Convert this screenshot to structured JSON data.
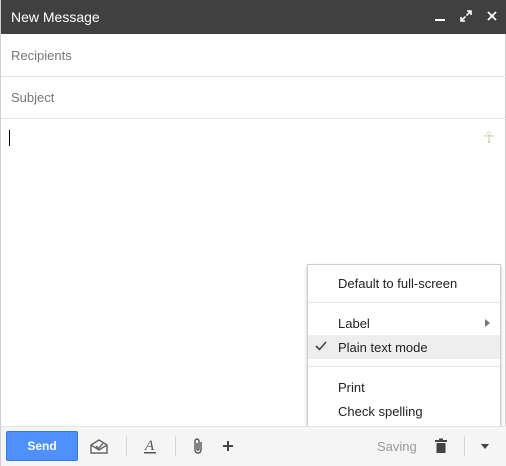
{
  "window": {
    "title": "New Message"
  },
  "fields": {
    "recipients_placeholder": "Recipients",
    "subject_placeholder": "Subject"
  },
  "body": {
    "text": "",
    "signature_icon": "ankh-icon"
  },
  "menu": {
    "items": [
      {
        "label": "Default to full-screen",
        "checked": false,
        "submenu": false
      },
      {
        "label": "Label",
        "checked": false,
        "submenu": true
      },
      {
        "label": "Plain text mode",
        "checked": true,
        "submenu": false,
        "highlighted": true
      },
      {
        "label": "Print",
        "checked": false,
        "submenu": false
      },
      {
        "label": "Check spelling",
        "checked": false,
        "submenu": false
      }
    ]
  },
  "toolbar": {
    "send_label": "Send",
    "status_text": "Saving",
    "icons": [
      "confidential-mode-icon",
      "formatting-icon",
      "attach-icon",
      "plus-icon",
      "trash-icon",
      "more-options-icon"
    ]
  },
  "colors": {
    "titlebar": "#404040",
    "send": "#4d90fe",
    "highlight": "#eeeeee"
  }
}
